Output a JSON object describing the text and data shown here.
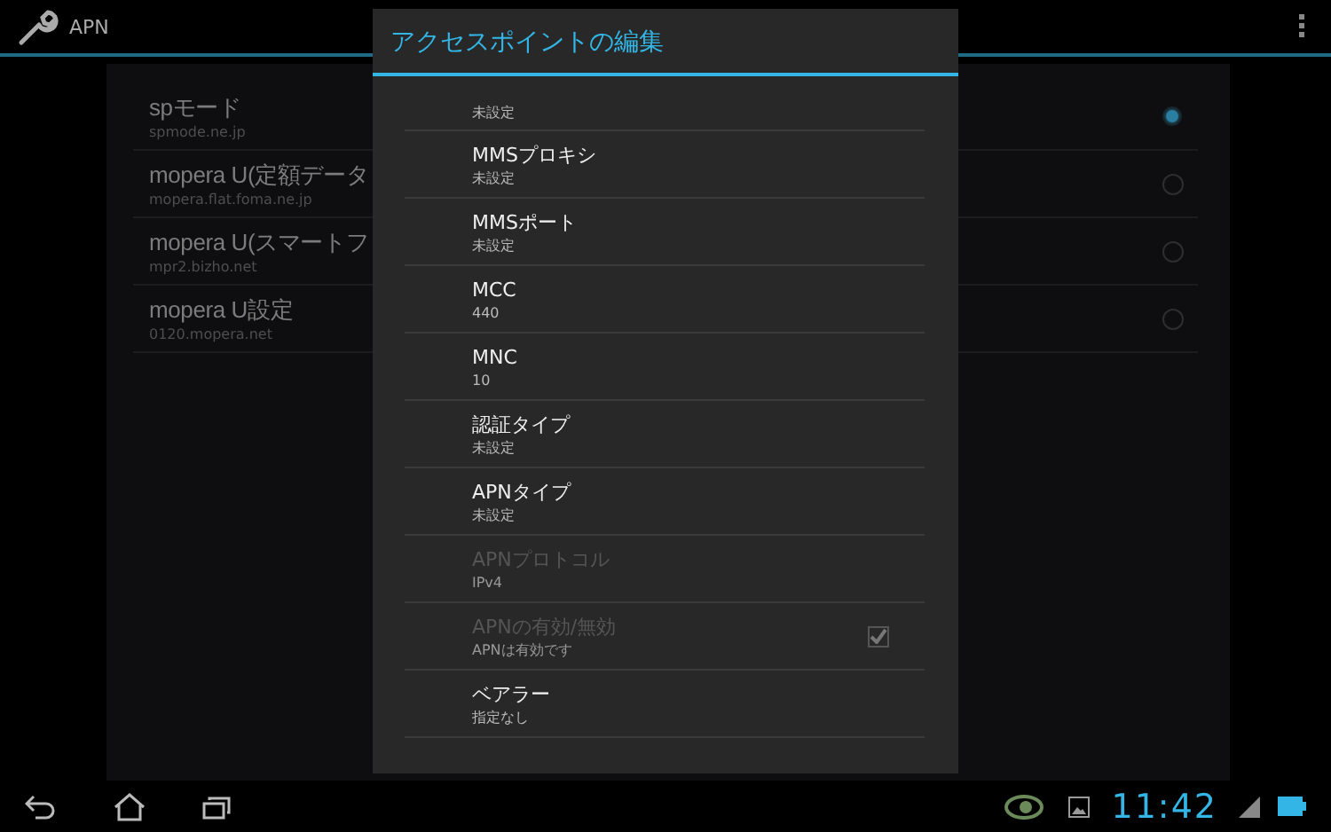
{
  "action_bar": {
    "title": "APN"
  },
  "apn_list": [
    {
      "name": "spモード",
      "apn": "spmode.ne.jp",
      "selected": true
    },
    {
      "name": "mopera U(定額データ",
      "apn": "mopera.flat.foma.ne.jp",
      "selected": false
    },
    {
      "name": "mopera U(スマートフ",
      "apn": "mpr2.bizho.net",
      "selected": false
    },
    {
      "name": "mopera U設定",
      "apn": "0120.mopera.net",
      "selected": false
    }
  ],
  "dialog": {
    "title": "アクセスポイントの編集",
    "items": [
      {
        "kind": "partial",
        "summary": "未設定"
      },
      {
        "kind": "text",
        "title": "MMSプロキシ",
        "summary": "未設定",
        "disabled": false
      },
      {
        "kind": "text",
        "title": "MMSポート",
        "summary": "未設定",
        "disabled": false
      },
      {
        "kind": "text",
        "title": "MCC",
        "summary": "440",
        "disabled": false
      },
      {
        "kind": "text",
        "title": "MNC",
        "summary": "10",
        "disabled": false
      },
      {
        "kind": "text",
        "title": "認証タイプ",
        "summary": "未設定",
        "disabled": false
      },
      {
        "kind": "text",
        "title": "APNタイプ",
        "summary": "未設定",
        "disabled": false
      },
      {
        "kind": "text",
        "title": "APNプロトコル",
        "summary": "IPv4",
        "disabled": true
      },
      {
        "kind": "checkbox",
        "title": "APNの有効/無効",
        "summary": "APNは有効です",
        "disabled": true,
        "checked": true
      },
      {
        "kind": "text",
        "title": "ベアラー",
        "summary": "指定なし",
        "disabled": false
      }
    ]
  },
  "status_bar": {
    "time": "11:42"
  }
}
